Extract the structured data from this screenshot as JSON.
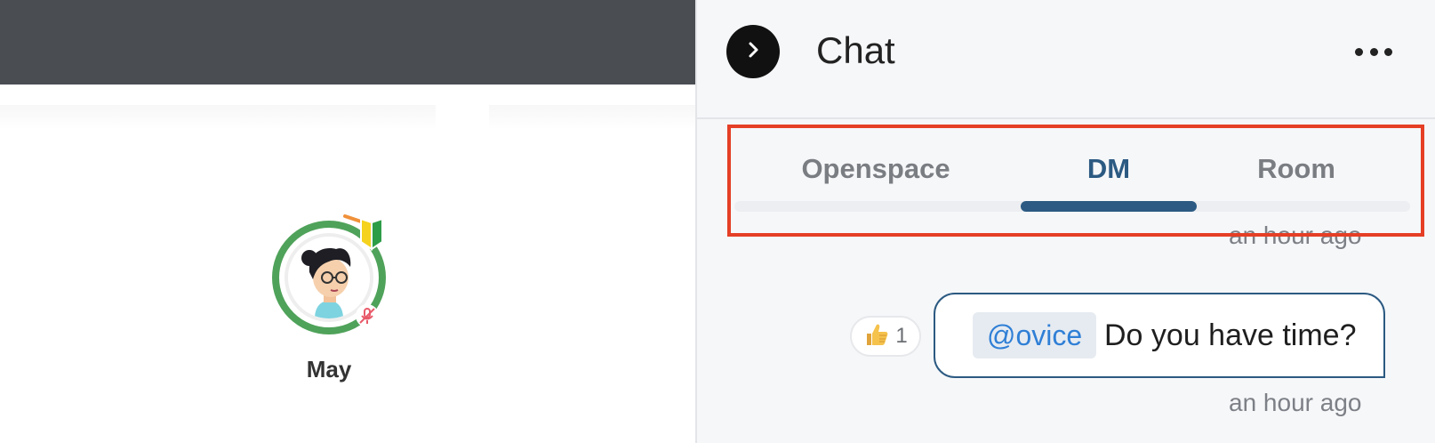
{
  "workspace": {
    "user": {
      "name": "May"
    }
  },
  "chat": {
    "title": "Chat",
    "tabs": [
      {
        "label": "Openspace",
        "active": false
      },
      {
        "label": "DM",
        "active": true
      },
      {
        "label": "Room",
        "active": false
      }
    ],
    "messages": [
      {
        "timestamp": "an hour ago"
      },
      {
        "mention": "@ovice",
        "text": "Do you have time?",
        "reaction": {
          "emoji_icon": "thumbs-up-icon",
          "count": "1"
        },
        "timestamp": "an hour ago"
      }
    ]
  },
  "colors": {
    "topbar": "#4a4d52",
    "accent": "#2c5a82",
    "highlight": "#e53f26",
    "ring": "#4fa25a",
    "mention": "#2f7fd6"
  }
}
